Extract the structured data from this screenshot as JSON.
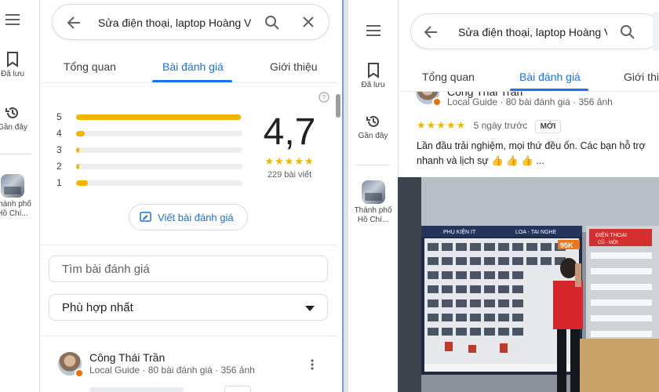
{
  "search": {
    "query": "Sửa điện thoại, laptop Hoàng V"
  },
  "rail": {
    "saved_label": "Đã lưu",
    "recent_label": "Gần đây",
    "place_label_1": "Thành phố",
    "place_label_2": "Hồ Chí..."
  },
  "tabs": [
    {
      "label": "Tổng quan"
    },
    {
      "label": "Bài đánh giá"
    },
    {
      "label": "Giới thiệu"
    }
  ],
  "summary": {
    "average": "4,7",
    "count_label": "229 bài viết",
    "star_glyphs": "★★★★★",
    "distribution": [
      {
        "star": "5",
        "fraction": 0.99
      },
      {
        "star": "4",
        "fraction": 0.05
      },
      {
        "star": "3",
        "fraction": 0.02
      },
      {
        "star": "2",
        "fraction": 0.02
      },
      {
        "star": "1",
        "fraction": 0.07
      }
    ]
  },
  "actions": {
    "write_review": "Viết bài đánh giá",
    "search_reviews_placeholder": "Tìm bài đánh giá",
    "sort_selected": "Phù hợp nhất"
  },
  "review": {
    "author": "Công Thái Trần",
    "meta": "Local Guide · 80 bài đánh giá · 356 ảnh",
    "stars": "★★★★★",
    "time": "5 ngày trước",
    "new_badge": "MỚI",
    "text_line1": "Lần đầu trải nghiệm, mọi thứ đều ổn. Các bạn hỗ trợ",
    "text_line2": "nhanh và lịch sự 👍 👍 👍 ..."
  },
  "photo": {
    "sign_phukien": "PHỤ KIỆN IT",
    "sign_loa": "LOA - TAI NGHE",
    "sign_dienthoai": "ĐIỆN THOẠI",
    "sign_cumoi": "CŨ - MỚI",
    "price_tag": "95K"
  },
  "colors": {
    "accent": "#1a73e8",
    "star": "#f2b600"
  }
}
